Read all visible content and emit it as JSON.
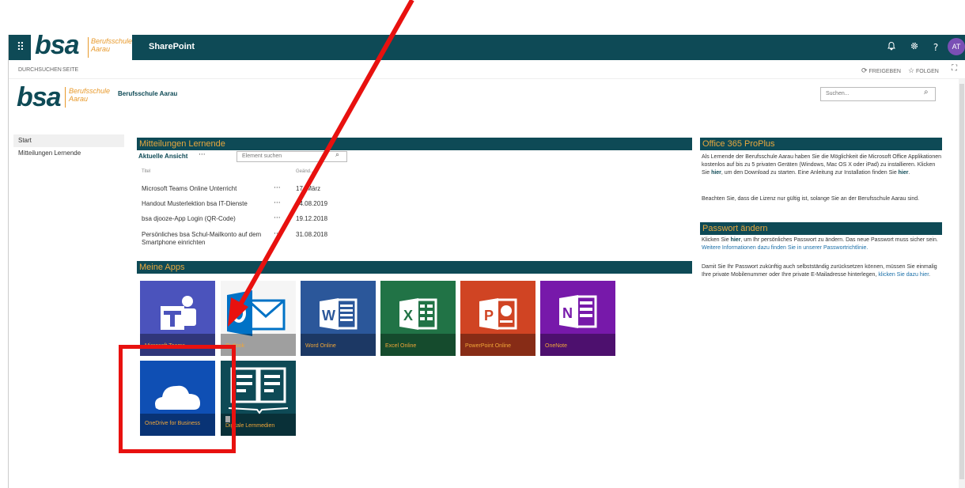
{
  "suite": {
    "brand": "bsa",
    "brand_sub": "Berufsschule Aarau",
    "title": "SharePoint",
    "avatar": "AT",
    "icons": [
      "bell-icon",
      "gear-icon",
      "help-icon"
    ]
  },
  "ribbon": {
    "tab1": "DURCHSUCHEN",
    "tab2": "SEITE",
    "share": "FREIGEBEN",
    "follow": "FOLGEN"
  },
  "site": {
    "brand": "bsa",
    "brand_sub": "Berufsschule Aarau",
    "title": "Berufsschule Aarau",
    "search_placeholder": "Suchen..."
  },
  "left_nav": {
    "items": [
      "Start",
      "Mitteilungen Lernende"
    ]
  },
  "announcements": {
    "title": "Mitteilungen Lernende",
    "view": "Aktuelle Ansicht",
    "view_more": "···",
    "search_placeholder": "Element suchen",
    "col_title": "Titel",
    "col_changed": "Geänd...",
    "rows": [
      {
        "title": "Microsoft Teams Online Unterricht",
        "dots": "···",
        "date": "17. März"
      },
      {
        "title": "Handout Musterlektion bsa IT-Dienste",
        "dots": "···",
        "date": "14.08.2019"
      },
      {
        "title": "bsa djooze-App Login (QR-Code)",
        "dots": "···",
        "date": "19.12.2018"
      },
      {
        "title": "Persönliches bsa Schul-Mailkonto auf dem Smartphone einrichten",
        "dots": "···",
        "date": "31.08.2018"
      }
    ]
  },
  "apps": {
    "title": "Meine Apps",
    "tiles": [
      {
        "label": "Microsoft Teams",
        "color": "#4b53bc",
        "icon": "teams-icon"
      },
      {
        "label": "Outlook",
        "color": "#f5f5f5",
        "icon": "outlook-icon"
      },
      {
        "label": "Word Online",
        "color": "#2b579a",
        "icon": "word-icon"
      },
      {
        "label": "Excel Online",
        "color": "#217346",
        "icon": "excel-icon"
      },
      {
        "label": "PowerPoint Online",
        "color": "#d04423",
        "icon": "powerpoint-icon"
      },
      {
        "label": "OneNote",
        "color": "#7719aa",
        "icon": "onenote-icon"
      },
      {
        "label": "OneDrive for Business",
        "color": "#0f4fb4",
        "icon": "onedrive-icon"
      },
      {
        "label": "Digitale Lernmedien",
        "color": "#0e4a56",
        "icon": "book-icon"
      }
    ]
  },
  "office": {
    "title": "Office 365 ProPlus",
    "p1_a": "Als Lernende der Berufsschule Aarau haben Sie die Möglichkeit die Microsoft Office Applikationen kostenlos auf bis zu 5 privaten Geräten (Windows, Mac OS X oder iPad) zu installieren. Klicken Sie ",
    "p1_link1": "hier",
    "p1_b": ", um den Download zu starten. Eine Anleitung zur Installation finden Sie ",
    "p1_link2": "hier",
    "p1_c": ".",
    "p2": "Beachten Sie, dass die Lizenz nur gültig ist, solange Sie an der Berufsschule Aarau sind."
  },
  "password": {
    "title": "Passwort ändern",
    "p1_a": "Klicken Sie ",
    "p1_link1": "hier",
    "p1_b": ", um Ihr persönliches Passwort zu ändern. Das neue Passwort muss sicher sein. ",
    "p1_link2": "Weitere Informationen dazu finden Sie in unserer Passwortrichtlinie.",
    "p2_a": "Damit Sie Ihr Passwort zukünftig auch selbstständig zurücksetzen können, müssen Sie einmalig Ihre private Mobilenummer oder Ihre private E-Mailadresse hinterlegen, ",
    "p2_link": "klicken Sie dazu hier",
    "p2_b": "."
  },
  "colors": {
    "teal": "#0e4a56",
    "orange": "#e89a2c",
    "annotation_red": "#e8110f"
  }
}
